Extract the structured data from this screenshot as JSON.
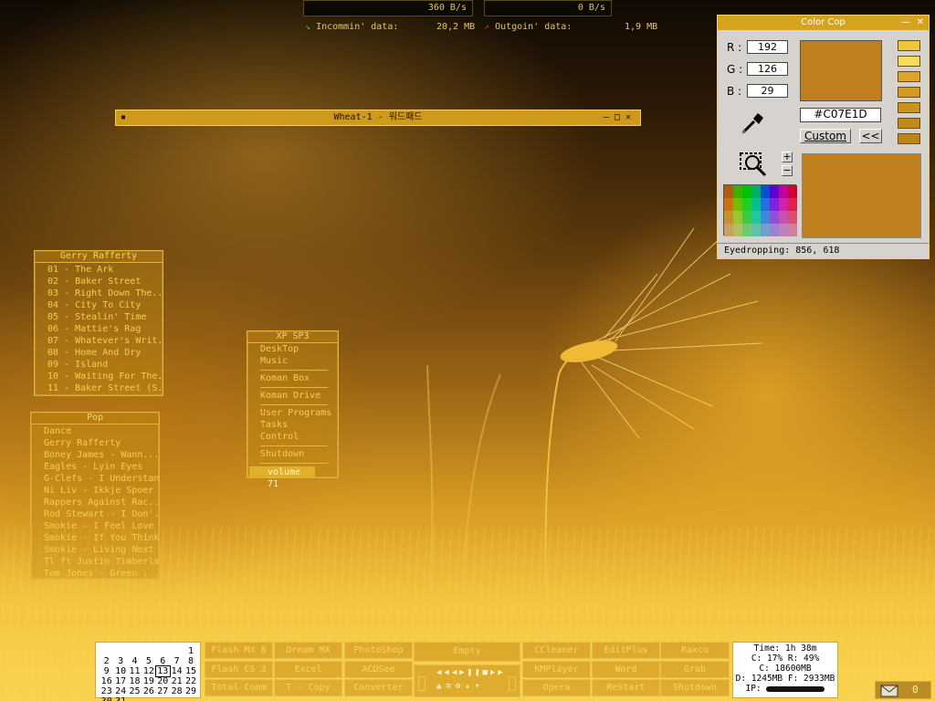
{
  "netmeter": {
    "in_rate": "360 B/s",
    "out_rate": "0 B/s",
    "in_label": "Incommin' data:",
    "in_value": "20,2 MB",
    "out_label": "Outgoin' data:",
    "out_value": "1,9 MB"
  },
  "wordpad": {
    "title": "Wheat-1 - 워드패드"
  },
  "playlist1": {
    "title": "Gerry Rafferty",
    "items": [
      "01 - The Ark",
      "02 - Baker Street",
      "03 - Right Down The...",
      "04 - City To City",
      "05 - Stealin' Time",
      "06 - Mattie's Rag",
      "07 - Whatever's Writ...",
      "08 - Home And Dry",
      "09 - Island",
      "10 - Waiting For The...",
      "11 - Baker Street (S..."
    ]
  },
  "playlist2": {
    "title": "Pop",
    "items": [
      "Dance",
      "Gerry Rafferty",
      "Boney James - Wann...",
      "Eagles - Lyin Eyes",
      "G-Clefs - I Understand",
      "Ni Liv - Ikkje Spoer",
      "Rappers Against Rac...",
      "Rod Stewart - I Don'...",
      "Smokie - I Feel Love",
      "Smokie - If You Think...",
      "Smokie - Living Next ...",
      "Tl ft Justin Timberlak...",
      "Tom Jones - Green ..."
    ]
  },
  "xpmenu": {
    "title": "XP SP3",
    "items": [
      "DeskTop",
      "Music",
      "Koman Box",
      "Koman Drive",
      "User Programs",
      "Tasks",
      "Control",
      "Shutdown"
    ],
    "volume": "volume 71"
  },
  "colorcop": {
    "title": "Color Cop",
    "r_label": "R :",
    "g_label": "G :",
    "b_label": "B :",
    "r": "192",
    "g": "126",
    "b": "29",
    "hex": "#C07E1D",
    "custom": "Custom",
    "back": "<<",
    "plus": "+",
    "minus": "−",
    "status": "Eyedropping: 856, 618",
    "current_color": "#C07E1D",
    "history": [
      "#f0c73a",
      "#f6dc58",
      "#dea52b",
      "#d29a24",
      "#c9921d",
      "#c48a19",
      "#bd8419"
    ],
    "palette": [
      [
        "#b05c10",
        "#3cb000",
        "#00c000",
        "#00b060",
        "#0050d0",
        "#6000d0",
        "#c000a0",
        "#d00030"
      ],
      [
        "#d07010",
        "#70c000",
        "#20d020",
        "#00c090",
        "#2070e0",
        "#8020e0",
        "#d020b0",
        "#e02050"
      ],
      [
        "#c8902a",
        "#98c830",
        "#40c840",
        "#20c8a0",
        "#4088d8",
        "#9050d8",
        "#c850b8",
        "#d85070"
      ],
      [
        "#c8a060",
        "#b0c060",
        "#70c870",
        "#60c0a8",
        "#70a0d0",
        "#a080d0",
        "#c080c0",
        "#d08098"
      ]
    ]
  },
  "calendar": {
    "rows": [
      [
        "",
        "",
        "",
        "",
        "",
        "",
        "1"
      ],
      [
        "2",
        "3",
        "4",
        "5",
        "6",
        "7",
        "8"
      ],
      [
        "9",
        "10",
        "11",
        "12",
        "13",
        "14",
        "15"
      ],
      [
        "16",
        "17",
        "18",
        "19",
        "20",
        "21",
        "22"
      ],
      [
        "23",
        "24",
        "25",
        "26",
        "27",
        "28",
        "29"
      ],
      [
        "30",
        "31",
        "",
        "",
        "",
        "",
        ""
      ]
    ]
  },
  "launcher": {
    "col1": [
      "Flash MX 8",
      "Flash CS 3",
      "Total Comm"
    ],
    "col2": [
      "Dream MX",
      "Excel",
      "T - Copy"
    ],
    "col3": [
      "PhotoShop",
      "ACDSee",
      "Converter"
    ],
    "empty": "Empty",
    "col5": [
      "CCleaner",
      "KMPlayer",
      "Opera"
    ],
    "col6": [
      "EditPlus",
      "Word",
      "ReStart"
    ],
    "col7": [
      "Raxco",
      "Grab",
      "Shutdown"
    ]
  },
  "sysinfo": {
    "time": "Time: 1h 38m",
    "cpu": "C: 17%  R: 49%",
    "c_drive": "C: 18600MB",
    "d_drive": "D: 1245MB F: 2933MB",
    "ip": "IP:"
  },
  "mail": {
    "count": "0"
  }
}
